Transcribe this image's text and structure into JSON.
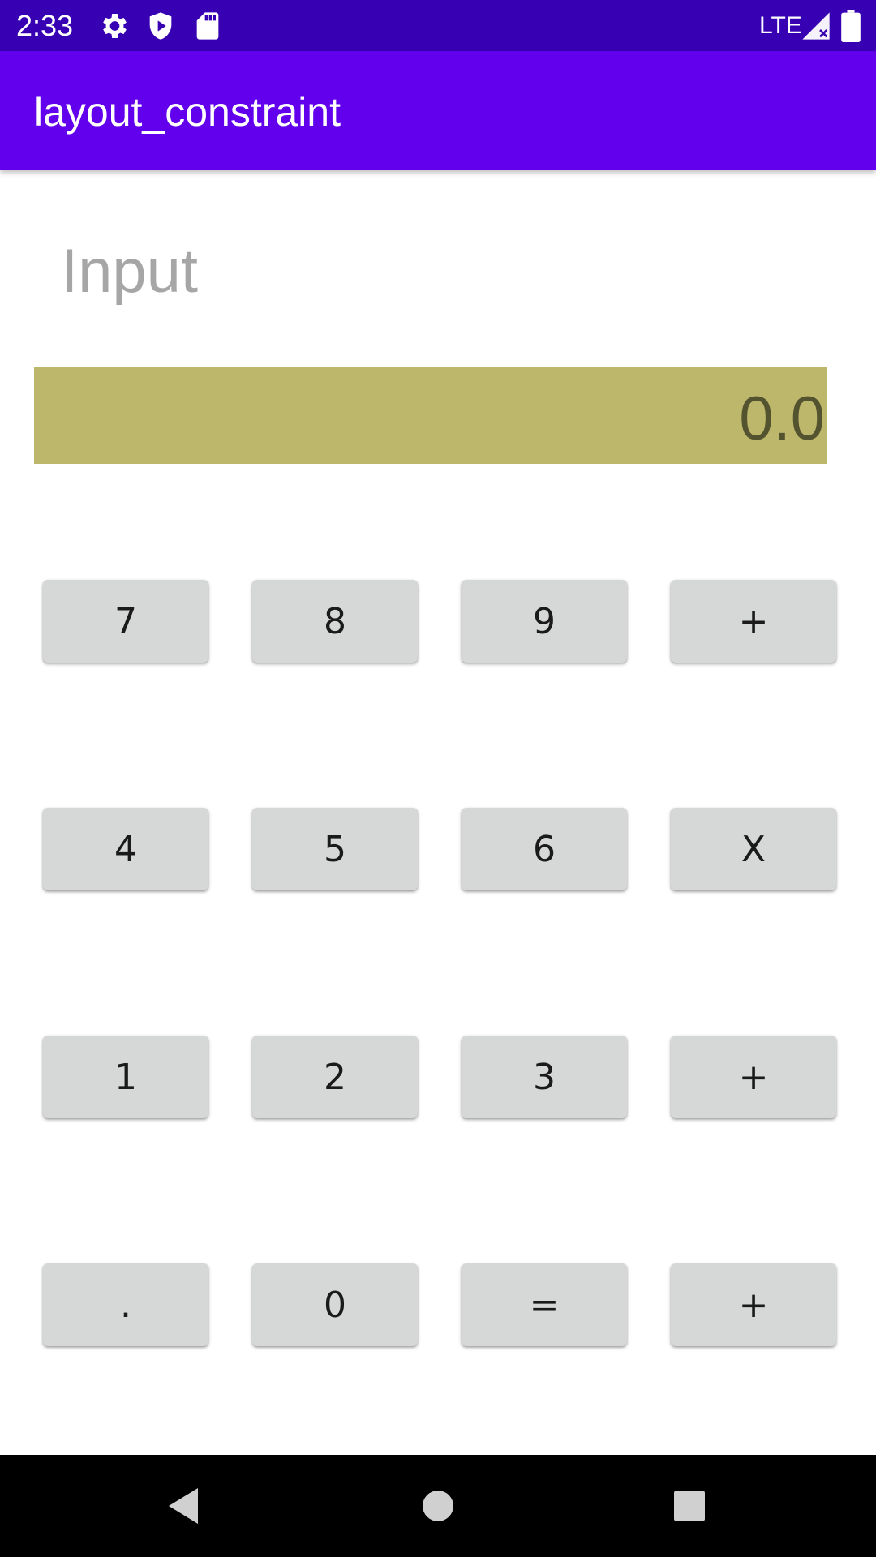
{
  "status_bar": {
    "time": "2:33",
    "network": "LTE",
    "icons": [
      "gear-icon",
      "play-protect-icon",
      "sd-card-icon",
      "signal-icon",
      "battery-icon"
    ]
  },
  "app_bar": {
    "title": "layout_constraint",
    "color": "#6200ee"
  },
  "input": {
    "label": "Input"
  },
  "result": {
    "value": "0.0",
    "background": "#bdb76b"
  },
  "keypad": {
    "rows": [
      [
        "7",
        "8",
        "9",
        "+"
      ],
      [
        "4",
        "5",
        "6",
        "X"
      ],
      [
        "1",
        "2",
        "3",
        "+"
      ],
      [
        ".",
        "0",
        "=",
        "+"
      ]
    ]
  },
  "nav_bar": {
    "icons": [
      "back-icon",
      "home-icon",
      "recents-icon"
    ]
  }
}
